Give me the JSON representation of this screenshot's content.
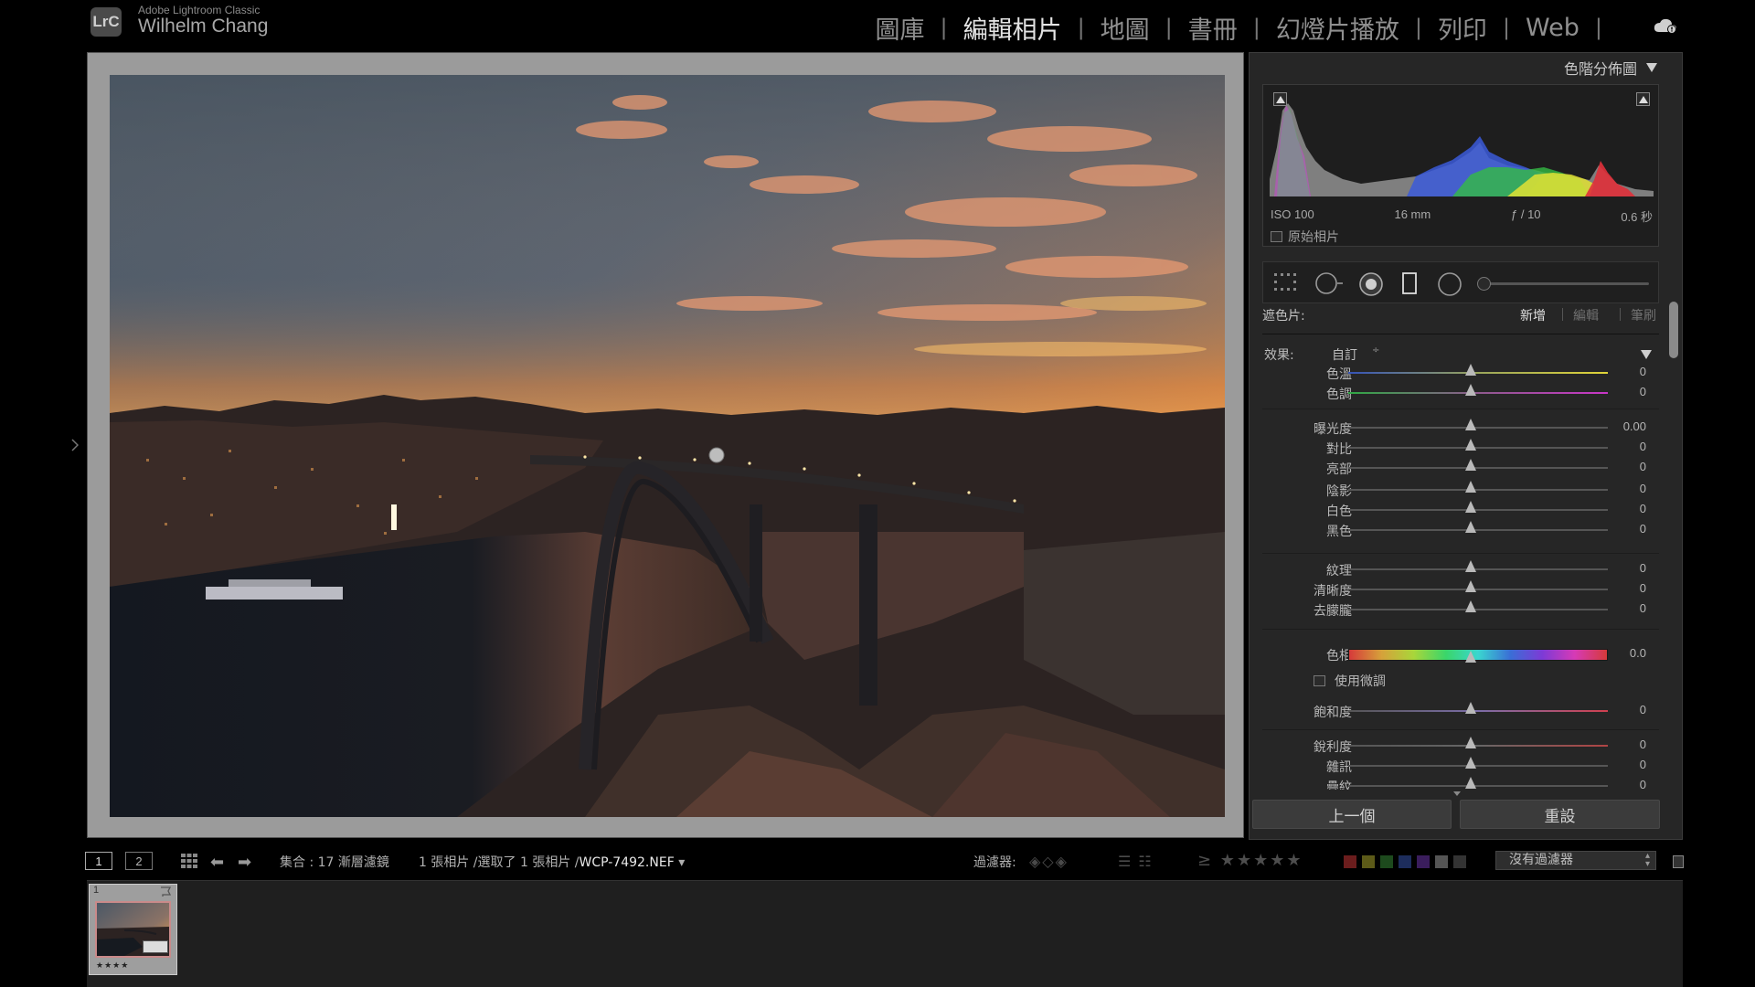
{
  "app": {
    "name": "Adobe Lightroom Classic",
    "logo_text": "LrC",
    "user": "Wilhelm Chang"
  },
  "modules": [
    {
      "label": "圖庫",
      "active": false
    },
    {
      "label": "編輯相片",
      "active": true
    },
    {
      "label": "地圖",
      "active": false
    },
    {
      "label": "書冊",
      "active": false
    },
    {
      "label": "幻燈片播放",
      "active": false
    },
    {
      "label": "列印",
      "active": false
    },
    {
      "label": "Web",
      "active": false
    }
  ],
  "module_separator": "|",
  "histogram": {
    "title": "色階分佈圖",
    "iso": "ISO 100",
    "focal_length": "16 mm",
    "aperture": "ƒ / 10",
    "shutter": "0.6 秒",
    "original_label": "原始相片"
  },
  "mask": {
    "label": "遮色片:",
    "new": "新增",
    "edit": "編輯",
    "brush": "筆刷"
  },
  "effect": {
    "label": "效果:",
    "value": "自訂",
    "caret": "÷"
  },
  "sliders": {
    "temp": {
      "label": "色溫",
      "value": "0"
    },
    "tint": {
      "label": "色調",
      "value": "0"
    },
    "exposure": {
      "label": "曝光度",
      "value": "0.00"
    },
    "contrast": {
      "label": "對比",
      "value": "0"
    },
    "highlights": {
      "label": "亮部",
      "value": "0"
    },
    "shadows": {
      "label": "陰影",
      "value": "0"
    },
    "whites": {
      "label": "白色",
      "value": "0"
    },
    "blacks": {
      "label": "黑色",
      "value": "0"
    },
    "texture": {
      "label": "紋理",
      "value": "0"
    },
    "clarity": {
      "label": "清晰度",
      "value": "0"
    },
    "dehaze": {
      "label": "去朦朧",
      "value": "0"
    },
    "hue": {
      "label": "色相",
      "value": "0.0"
    },
    "saturation": {
      "label": "飽和度",
      "value": "0"
    },
    "sharpness": {
      "label": "銳利度",
      "value": "0"
    },
    "noise": {
      "label": "雜訊",
      "value": "0"
    },
    "moire": {
      "label": "疊紋",
      "value": "0"
    }
  },
  "fine_adjust_label": "使用微調",
  "buttons": {
    "previous": "上一個",
    "reset": "重設"
  },
  "filmstrip_bar": {
    "page1": "1",
    "page2": "2",
    "collection": "集合 : 17 漸層濾鏡",
    "selection": "1 張相片 /選取了 1 張相片 /",
    "filename": "WCP-7492.NEF",
    "filename_caret": "▾",
    "filter_label": "過濾器:",
    "rating_prefix": "≥ ★★★★★",
    "filter_select": "沒有過濾器",
    "color_chips": [
      "#6b1d1d",
      "#5c5a18",
      "#1d4a1d",
      "#1d2d5c",
      "#3a1d5c",
      "#555555",
      "#333333"
    ]
  },
  "thumbnail": {
    "index": "1",
    "stars": "★★★★"
  }
}
